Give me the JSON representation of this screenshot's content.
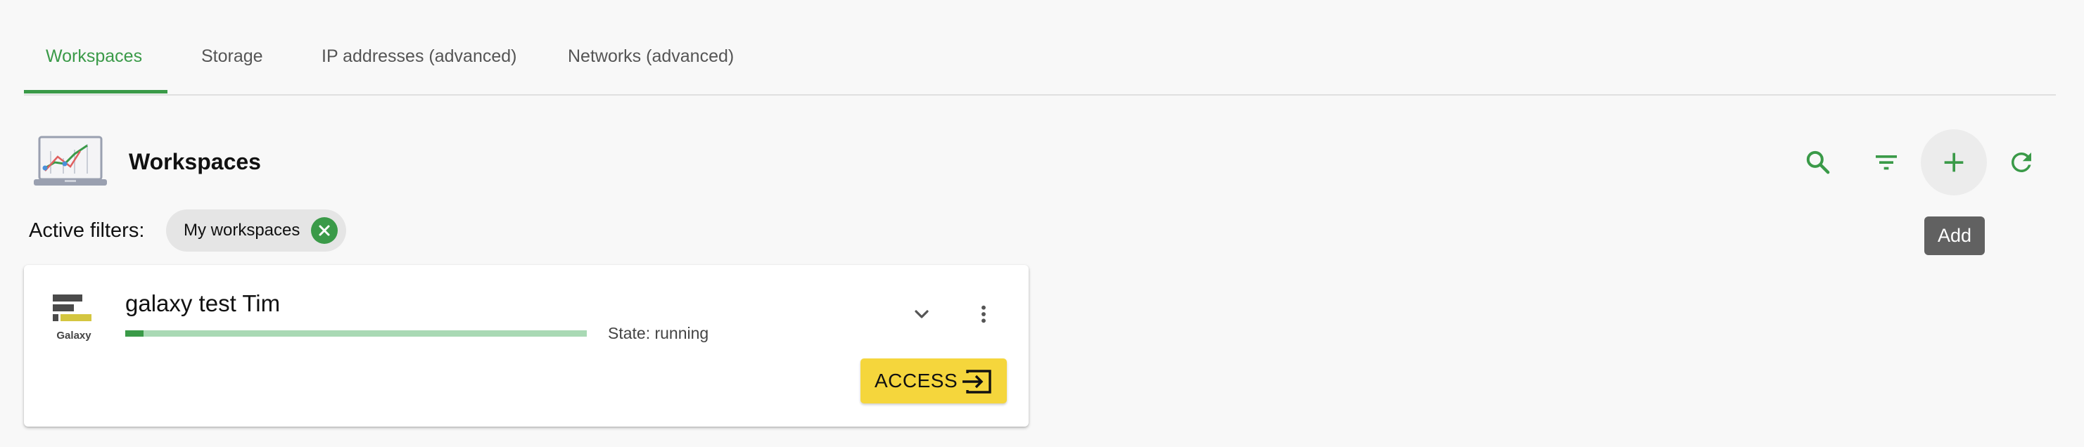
{
  "tabs": [
    {
      "label": "Workspaces",
      "active": true
    },
    {
      "label": "Storage",
      "active": false
    },
    {
      "label": "IP addresses (advanced)",
      "active": false
    },
    {
      "label": "Networks (advanced)",
      "active": false
    }
  ],
  "header": {
    "title": "Workspaces",
    "icon": "laptop-chart-icon"
  },
  "toolbar": {
    "search_icon": "search-icon",
    "filter_icon": "filter-icon",
    "add_icon": "plus-icon",
    "refresh_icon": "refresh-icon",
    "tooltip": "Add"
  },
  "filters": {
    "label": "Active filters:",
    "chips": [
      {
        "label": "My workspaces"
      }
    ]
  },
  "workspaces": [
    {
      "name": "galaxy test Tim",
      "app_label": "Galaxy",
      "state_text": "State: running",
      "progress": 0.04,
      "action_label": "ACCESS"
    }
  ],
  "colors": {
    "accent": "#3a9a48",
    "access_button": "#f5d63c",
    "tooltip_bg": "#616161"
  }
}
